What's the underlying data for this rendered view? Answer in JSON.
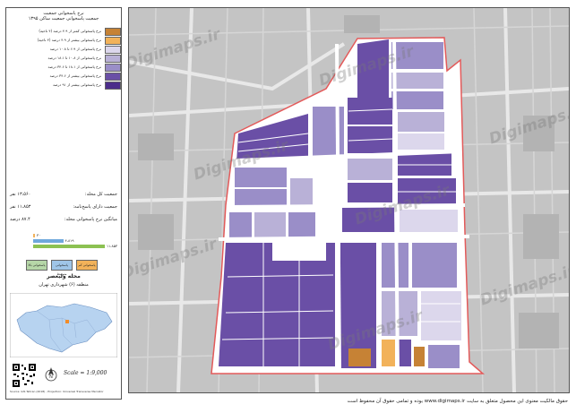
{
  "legend": {
    "title_line1": "نرخ پاسخوانی جمعیت",
    "title_line2": "جمعیت پاسخوانی جمعیت ساکن ۱۳۹۵",
    "items": [
      {
        "label": "نرخ پاسخوانی کمتر از ۴.۹ درصد (۴ ناحیه)",
        "color": "#c68235"
      },
      {
        "label": "نرخ پاسخوانی بیشتر از ۴.۹ درصد (۴ ناحیه)",
        "color": "#f2b25a"
      },
      {
        "label": "نرخ پاسخوانی از ۶.۹ تا ۱۰.۸ درصد",
        "color": "#dcd7ec"
      },
      {
        "label": "نرخ پاسخوانی از ۱۰.۸ تا ۱۸.۱ درصد",
        "color": "#b9b1d7"
      },
      {
        "label": "نرخ پاسخوانی از ۱۸.۱ تا ۳۴.۶ درصد",
        "color": "#9a8ec8"
      },
      {
        "label": "نرخ پاسخوانی بیشتر از ۳۴.۶ درصد",
        "color": "#6a4fa6"
      },
      {
        "label": "نرخ پاسخوانی بیشتر از ۹۱ درصد",
        "color": "#4b2d8a"
      }
    ],
    "stats": [
      {
        "label": "جمعیت کل محله:",
        "value": "۱۳،۵۶۰ نفر"
      },
      {
        "label": "جمعیت دارای پاسخ‌نامه:",
        "value": "۱۱،۸۵۳ نفر"
      },
      {
        "label": "میانگین نرخ پاسخوانی محله:",
        "value": "۸۷.۴ درصد"
      }
    ],
    "bars": [
      {
        "value": "۳۰",
        "color": "#f2b25a",
        "fill": 0.02
      },
      {
        "value": "۴،۸۱۹",
        "color": "#6fa8dc",
        "fill": 0.42
      },
      {
        "value": "۱۱،۸۵۳",
        "color": "#8cc152",
        "fill": 1.0
      }
    ],
    "swatches": [
      {
        "label": "پاسخوانی کم",
        "color": "#f2b25a"
      },
      {
        "label": "پاسخوانی متوسط",
        "color": "#9fc5e8"
      },
      {
        "label": "پاسخوانی بالا",
        "color": "#b6d7a8"
      }
    ],
    "area_title": "محله وليعصر",
    "area_subtitle": "منطقه (۶) شهرداری تهران",
    "scale": "Scale = 1:9,000",
    "credit": "Source: GIS Tehran (2018) - Projection: Universal Transverse Mercator"
  },
  "map": {
    "watermark": "Digimaps.ir",
    "boundary_color": "#e35a5a"
  },
  "footer": "حقوق مالکیت معنوی این محصول متعلق به سایت www.digimaps.ir بوده و تمامی حقوق آن محفوظ است"
}
